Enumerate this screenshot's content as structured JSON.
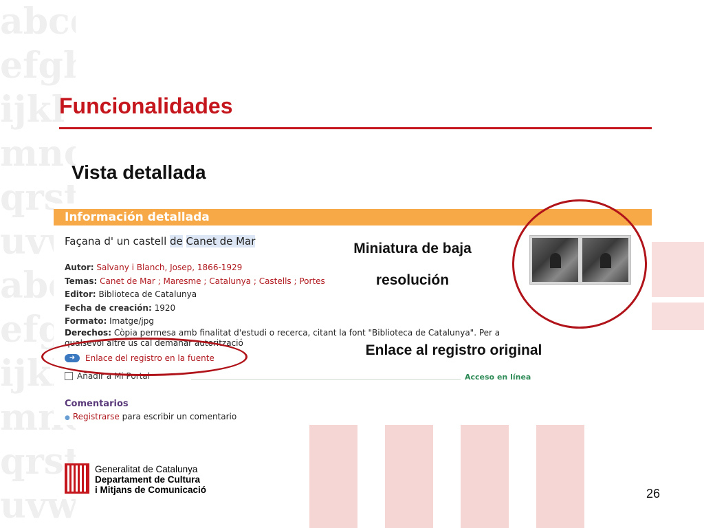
{
  "slide": {
    "title": "Funcionalidades",
    "subtitle": "Vista detallada",
    "page_number": "26"
  },
  "panel": {
    "header": "Información detallada",
    "record_title": {
      "prefix": "Façana d' un castell ",
      "part1": "de",
      "space": " ",
      "part2": "Canet de Mar"
    },
    "fields": [
      {
        "label": "Autor:",
        "value": "Salvany i Blanch, Josep, 1866-1929",
        "style": "link"
      },
      {
        "label": "Temas:",
        "value": "Canet de Mar ; Maresme ; Catalunya ; Castells ; Portes",
        "style": "link"
      },
      {
        "label": "Editor:",
        "value": "Biblioteca de Catalunya",
        "style": "plain"
      },
      {
        "label": "Fecha de creación:",
        "value": "1920",
        "style": "plain"
      },
      {
        "label": "Formato:",
        "value": "Imatge/jpg",
        "style": "plain"
      }
    ],
    "rights_label": "Derechos:",
    "rights_text": "Còpia permesa amb finalitat d'estudi o recerca, citant la font \"Biblioteca de Catalunya\". Per a qualsevol altre ús cal demanar autorització",
    "source_link": "Enlace del registro en la fuente",
    "add_portal": "Añadir a Mi Portal",
    "access": "Acceso en línea",
    "comments_heading": "Comentarios",
    "register_link": "Registrarse",
    "register_suffix": "para escribir un comentario"
  },
  "annotations": {
    "thumbnail_line1": "Miniatura de baja",
    "thumbnail_line2": "resolución",
    "original_link": "Enlace al registro original"
  },
  "footer": {
    "org_line1": "Generalitat de Catalunya",
    "org_line2": "Departament de Cultura",
    "org_line3": "i Mitjans de Comunicació"
  },
  "colors": {
    "accent_red": "#c4161c",
    "panel_header_orange": "#f7a947",
    "link_red": "#b0191f",
    "access_green": "#2e8b57"
  }
}
